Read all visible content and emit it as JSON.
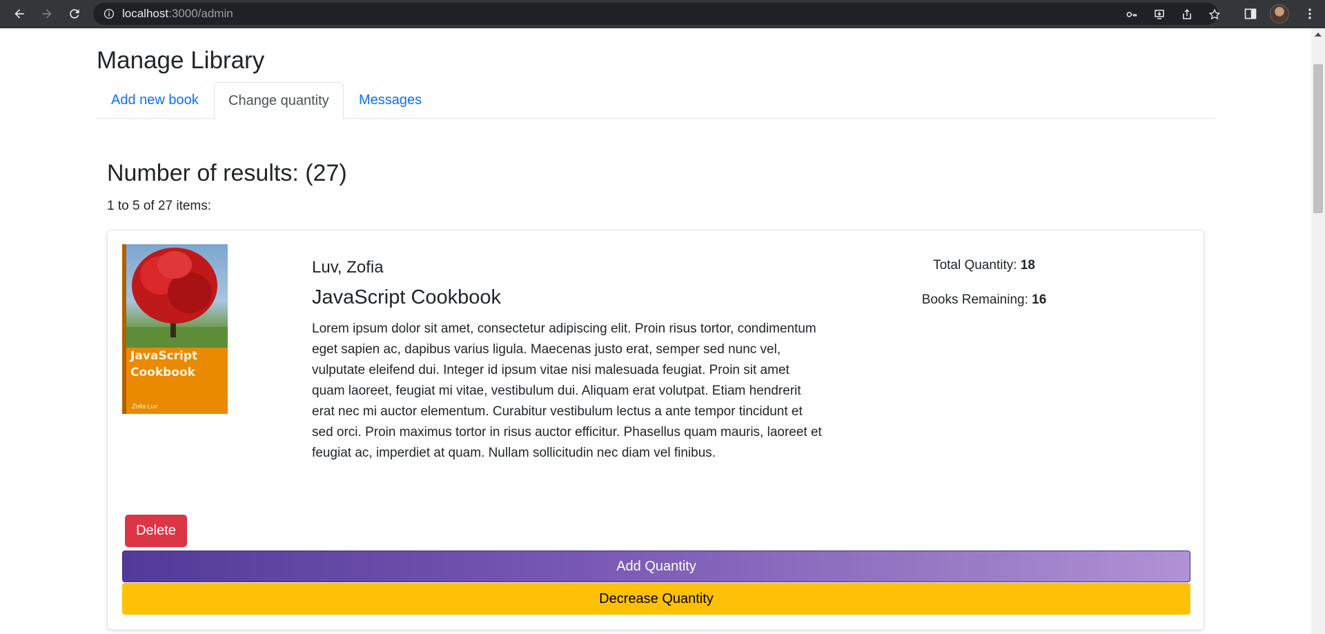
{
  "browser": {
    "url_host": "localhost",
    "url_path": ":3000/admin"
  },
  "page": {
    "title": "Manage Library",
    "tabs": [
      {
        "label": "Add new book",
        "active": false
      },
      {
        "label": "Change quantity",
        "active": true
      },
      {
        "label": "Messages",
        "active": false
      }
    ],
    "results_title": "Number of results: (27)",
    "results_sub": "1 to 5 of 27 items:"
  },
  "book": {
    "cover": {
      "title_line1": "JavaScript",
      "title_line2": "Cookbook",
      "author": "Zofia Luv"
    },
    "author": "Luv, Zofia",
    "title": "JavaScript Cookbook",
    "description": "Lorem ipsum dolor sit amet, consectetur adipiscing elit. Proin risus tortor, condimentum eget sapien ac, dapibus varius ligula. Maecenas justo erat, semper sed nunc vel, vulputate eleifend dui. Integer id ipsum vitae nisi malesuada feugiat. Proin sit amet quam laoreet, feugiat mi vitae, vestibulum dui. Aliquam erat volutpat. Etiam hendrerit erat nec mi auctor elementum. Curabitur vestibulum lectus a ante tempor tincidunt et sed orci. Proin maximus tortor in risus auctor efficitur. Phasellus quam mauris, laoreet et feugiat ac, imperdiet at quam. Nullam sollicitudin nec diam vel finibus.",
    "total_quantity_label": "Total Quantity:",
    "total_quantity": "18",
    "books_remaining_label": "Books Remaining:",
    "books_remaining": "16"
  },
  "actions": {
    "delete": "Delete",
    "add_quantity": "Add Quantity",
    "decrease_quantity": "Decrease Quantity"
  },
  "colors": {
    "link": "#0d6efd",
    "danger": "#dc3545",
    "warning": "#ffc107",
    "purple_start": "#533a98",
    "purple_end": "#b192d6"
  }
}
